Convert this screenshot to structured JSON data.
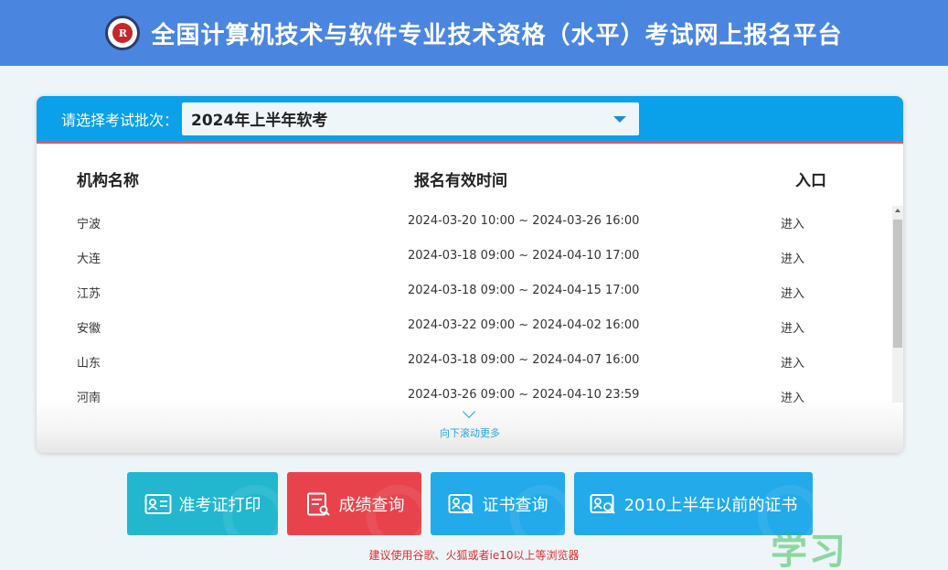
{
  "header": {
    "title": "全国计算机技术与软件专业技术资格（水平）考试网上报名平台",
    "logo_text": "R"
  },
  "batch": {
    "label": "请选择考试批次：",
    "selected": "2024年上半年软考"
  },
  "table": {
    "headers": {
      "name": "机构名称",
      "time": "报名有效时间",
      "entry": "入口"
    },
    "rows": [
      {
        "name": "宁波",
        "time": "2024-03-20 10:00 ~ 2024-03-26 16:00",
        "entry": "进入"
      },
      {
        "name": "大连",
        "time": "2024-03-18 09:00 ~ 2024-04-10 17:00",
        "entry": "进入"
      },
      {
        "name": "江苏",
        "time": "2024-03-18 09:00 ~ 2024-04-15 17:00",
        "entry": "进入"
      },
      {
        "name": "安徽",
        "time": "2024-03-22 09:00 ~ 2024-04-02 16:00",
        "entry": "进入"
      },
      {
        "name": "山东",
        "time": "2024-03-18 09:00 ~ 2024-04-07 16:00",
        "entry": "进入"
      },
      {
        "name": "河南",
        "time": "2024-03-26 09:00 ~ 2024-04-10 23:59",
        "entry": "进入"
      }
    ],
    "more_label": "向下滚动更多"
  },
  "buttons": {
    "admission": "准考证打印",
    "score": "成绩查询",
    "cert": "证书查询",
    "old_cert": "2010上半年以前的证书"
  },
  "note": "建议使用谷歌、火狐或者ie10以上等浏览器",
  "watermark": "学习",
  "colors": {
    "header": "#4a86e0",
    "accent": "#0aa0ea",
    "red": "#e8434c",
    "teal": "#22b7cf"
  }
}
